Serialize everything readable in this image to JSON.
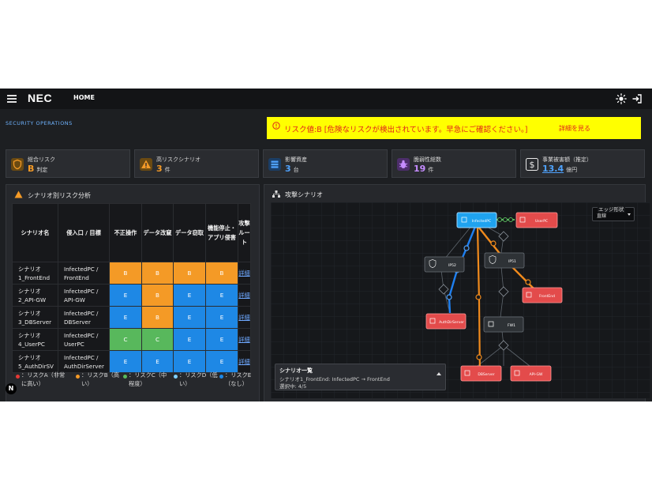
{
  "header": {
    "logo": "NEC",
    "home": "HOME"
  },
  "section_label": "SECURITY OPERATIONS",
  "alert": {
    "message": "リスク値:B [危険なリスクが検出されています。早急にご確認ください。]",
    "link": "詳細を見る"
  },
  "kpis": [
    {
      "label": "総合リスク",
      "value": "B",
      "unit": "判定",
      "color": "#f49a26",
      "icon": "shield-icon"
    },
    {
      "label": "高リスクシナリオ",
      "value": "3",
      "unit": "件",
      "color": "#f49a26",
      "icon": "warning-icon"
    },
    {
      "label": "影響資産",
      "value": "3",
      "unit": "台",
      "color": "#4fa3ff",
      "icon": "server-icon"
    },
    {
      "label": "脆弱性総数",
      "value": "19",
      "unit": "件",
      "color": "#c58cff",
      "icon": "bug-icon"
    },
    {
      "label": "事業被害額（推定）",
      "value": "13.4",
      "unit": "億円",
      "color": "#4fa3ff",
      "icon": "dollar-icon"
    }
  ],
  "risk_panel": {
    "title": "シナリオ別リスク分析",
    "headers": [
      "シナリオ名",
      "侵入口 / 目標",
      "不正操作",
      "データ改竄",
      "データ窃取",
      "機能停止・アプリ侵害",
      "攻撃ルート"
    ],
    "rows": [
      {
        "name": "シナリオ1_FrontEnd",
        "target": "InfectedPC / FrontEnd",
        "levels": [
          "B",
          "B",
          "B",
          "B"
        ],
        "route": "詳細"
      },
      {
        "name": "シナリオ2_API-GW",
        "target": "InfectedPC / API-GW",
        "levels": [
          "E",
          "B",
          "E",
          "E"
        ],
        "route": "詳細"
      },
      {
        "name": "シナリオ3_DBServer",
        "target": "InfectedPC / DBServer",
        "levels": [
          "E",
          "B",
          "E",
          "E"
        ],
        "route": "詳細"
      },
      {
        "name": "シナリオ4_UserPC",
        "target": "InfectedPC / UserPC",
        "levels": [
          "C",
          "C",
          "E",
          "E"
        ],
        "route": "詳細"
      },
      {
        "name": "シナリオ5_AuthDirSV",
        "target": "InfectedPC / AuthDirServer",
        "levels": [
          "E",
          "E",
          "E",
          "E"
        ],
        "route": "詳細"
      }
    ],
    "legend": [
      {
        "text": "：リスクA（非常に高い）",
        "color": "#e53935"
      },
      {
        "text": "：リスクB（高い）",
        "color": "#f49a26"
      },
      {
        "text": "：リスクC（中程度）",
        "color": "#58b85c"
      },
      {
        "text": "：リスクD（低い）",
        "color": "#7fd0ff"
      },
      {
        "text": "：リスクE（なし）",
        "color": "#1e88e5"
      }
    ]
  },
  "n_badge": "N",
  "attack_panel": {
    "title": "攻撃シナリオ",
    "edge_shape": {
      "label": "エッジ形状",
      "value": "直線"
    },
    "nodes": [
      {
        "id": "infected",
        "label": "InfectedPC",
        "color": "#1fa3ef"
      },
      {
        "id": "userpc",
        "label": "UserPC",
        "color": "#e34b4b"
      },
      {
        "id": "ip52",
        "label": "IP52",
        "color": "#2e3236"
      },
      {
        "id": "ip51",
        "label": "IP51",
        "color": "#2e3236"
      },
      {
        "id": "frontend",
        "label": "FrontEnd",
        "color": "#e34b4b"
      },
      {
        "id": "authdir",
        "label": "AuthDirServer",
        "color": "#e34b4b"
      },
      {
        "id": "fw1",
        "label": "FW1",
        "color": "#2e3236"
      },
      {
        "id": "dbserver",
        "label": "DBServer",
        "color": "#e34b4b"
      },
      {
        "id": "apigw",
        "label": "API-GW",
        "color": "#e34b4b"
      }
    ],
    "scenario_list": {
      "title": "シナリオ一覧",
      "current": "シナリオ1_FrontEnd: InfectedPC → FrontEnd",
      "selected": "選択中: 4/5"
    }
  }
}
